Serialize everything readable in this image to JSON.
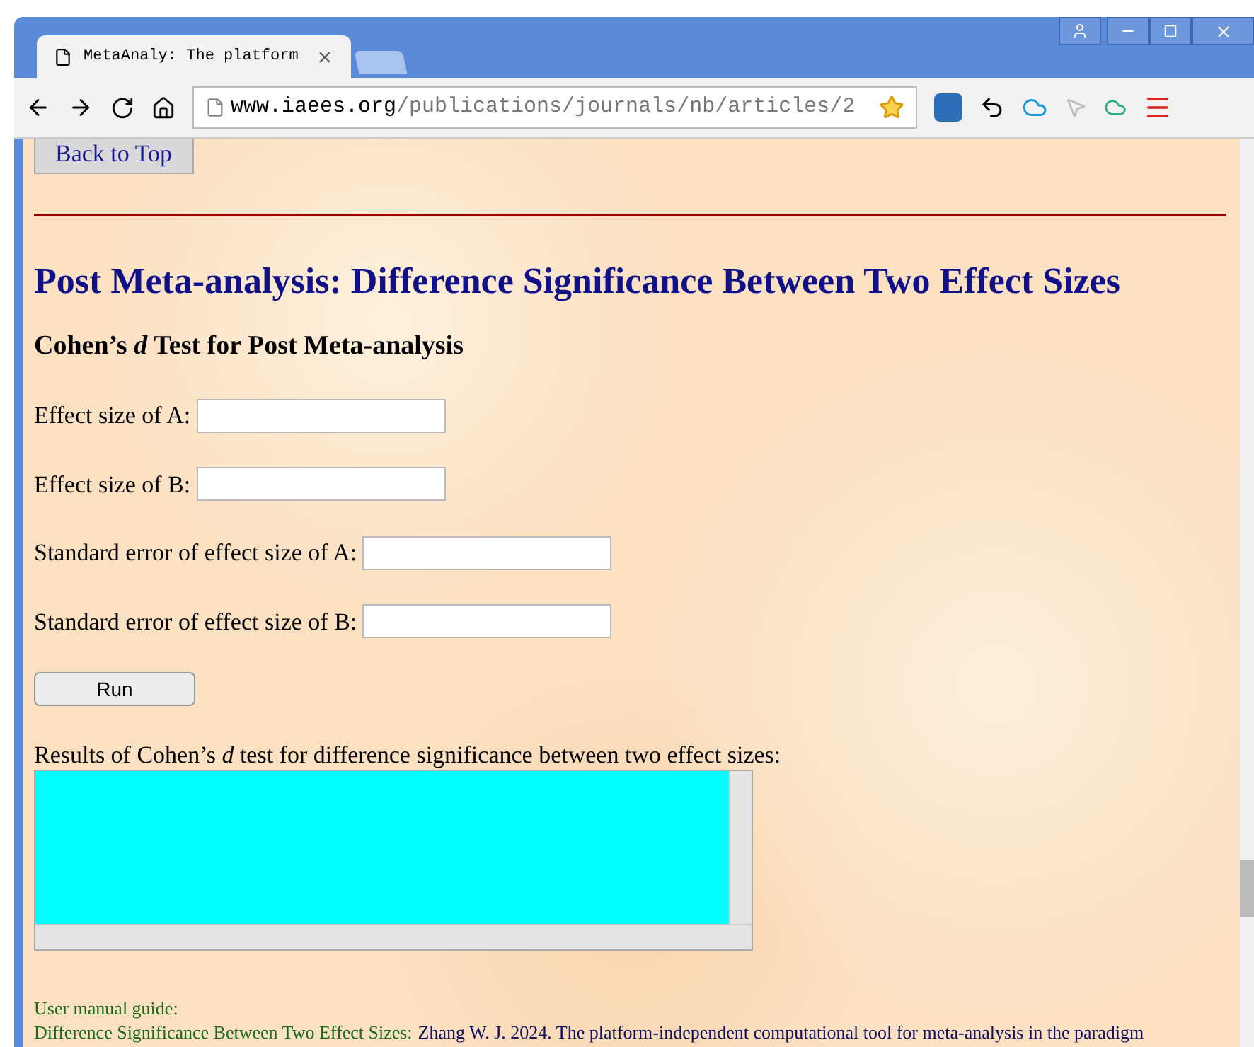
{
  "browser": {
    "tab": {
      "title": "MetaAnaly: The platform",
      "selected": true
    },
    "address": {
      "host": "www.iaees.org",
      "path": "/publications/journals/nb/articles/2"
    }
  },
  "page": {
    "back_to_top": "Back to Top",
    "heading": "Post Meta-analysis: Difference Significance Between Two Effect Sizes",
    "subheading": "Cohen’s *d* Test for Post Meta-analysis",
    "fields": [
      {
        "label": "Effect size of A:"
      },
      {
        "label": "Effect size of B:"
      },
      {
        "label": "Standard error of effect size of A:"
      },
      {
        "label": "Standard error of effect size of B:"
      }
    ],
    "run_button": "Run",
    "results_label": "Results of Cohen’s *d* test for difference significance between two effect sizes:",
    "guide_label": "User manual guide:",
    "guide_link": "Difference Significance Between Two Effect Sizes:",
    "guide_citation": "Zhang W. J. 2024. The platform-independent computational tool for meta-analysis in the paradigm"
  }
}
